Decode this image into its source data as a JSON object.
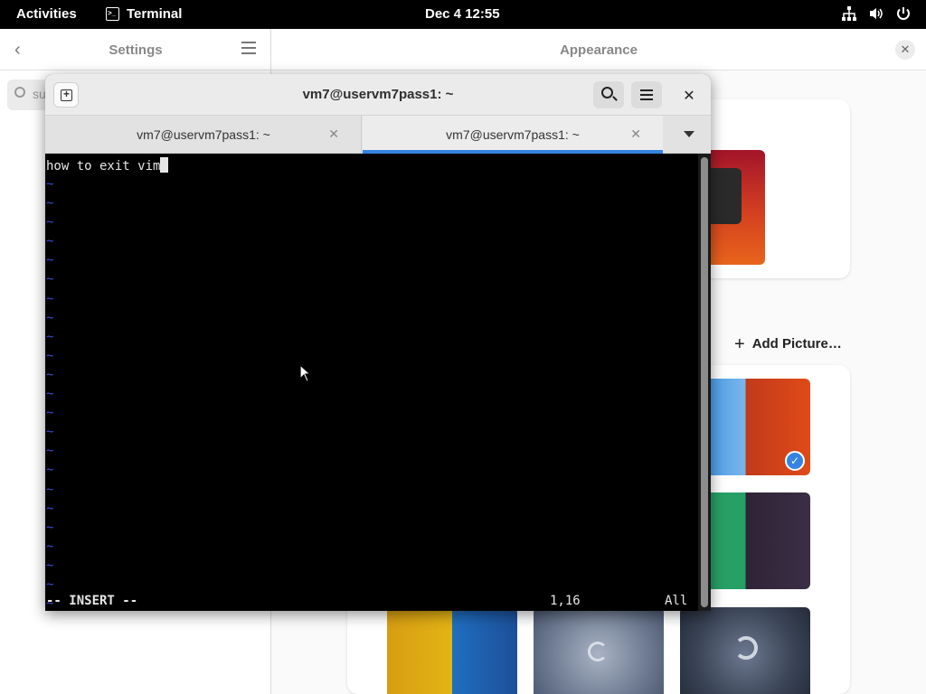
{
  "topbar": {
    "activities": "Activities",
    "app_name": "Terminal",
    "clock": "Dec 4  12:55",
    "tray_icons": [
      "network-icon",
      "volume-icon",
      "power-icon"
    ]
  },
  "settings": {
    "sidebar_title": "Settings",
    "search_placeholder": "su",
    "panel_title": "Appearance",
    "add_picture_label": "Add Picture…"
  },
  "terminal": {
    "window_title": "vm7@uservm7pass1: ~",
    "tabs": [
      {
        "label": "vm7@uservm7pass1: ~",
        "active": false
      },
      {
        "label": "vm7@uservm7pass1: ~",
        "active": true
      }
    ],
    "buffer_text": "how to exit vim",
    "empty_line_marker": "~",
    "empty_line_count": 23,
    "status_mode": "-- INSERT --",
    "status_position": "1,16",
    "status_percent": "All"
  },
  "colors": {
    "accent": "#3584e4",
    "vim_tilde": "#3b4bd6",
    "terminal_bg": "#000000"
  }
}
